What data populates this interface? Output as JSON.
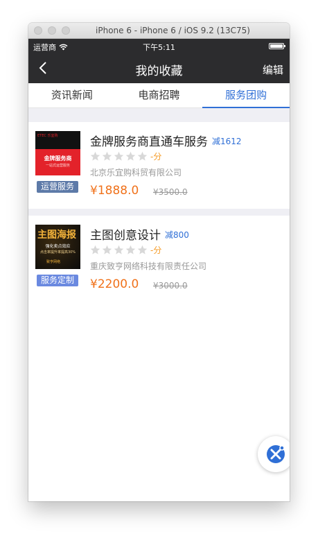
{
  "simulator": {
    "title": "iPhone 6 - iPhone 6 / iOS 9.2 (13C75)"
  },
  "status_bar": {
    "carrier": "运营商",
    "time": "下午5:11"
  },
  "nav": {
    "title": "我的收藏",
    "edit_label": "编辑",
    "back_icon": "chevron-left-icon"
  },
  "tabs": [
    {
      "label": "资讯新闻",
      "active": false
    },
    {
      "label": "电商招聘",
      "active": false
    },
    {
      "label": "服务团购",
      "active": true
    }
  ],
  "items": [
    {
      "name": "金牌服务商直通车服务",
      "discount": "减1612",
      "score": "-分",
      "stars_filled": 0,
      "stars_total": 5,
      "company": "北京乐宜购科贸有限公司",
      "price": "¥1888.0",
      "original_price": "¥3500.0",
      "tag": "运营服务",
      "thumb": {
        "top": "ETEC 乐宜购",
        "main": "金牌服务商",
        "sub": "一站式运营服务"
      }
    },
    {
      "name": "主图创意设计",
      "discount": "减800",
      "score": "-分",
      "stars_filled": 0,
      "stars_total": 5,
      "company": "重庆致亨网络科技有限责任公司",
      "price": "¥2200.0",
      "original_price": "¥3000.0",
      "tag": "服务定制",
      "thumb": {
        "top": "主图海报",
        "main": "强化卖点效应",
        "sub": "点击率提升率提高30%",
        "brand": "致亨网络"
      }
    }
  ],
  "colors": {
    "nav_bg": "#2c2c2e",
    "accent": "#2f6fd6",
    "price": "#f0711a",
    "score": "#f59a23"
  },
  "fab": {
    "icon": "assistive-touch-icon"
  }
}
